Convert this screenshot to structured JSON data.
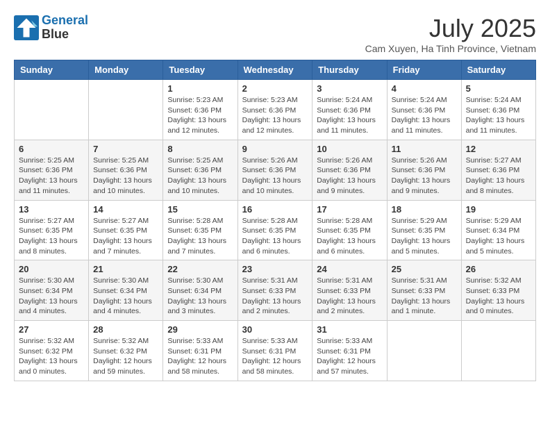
{
  "header": {
    "logo_line1": "General",
    "logo_line2": "Blue",
    "month": "July 2025",
    "location": "Cam Xuyen, Ha Tinh Province, Vietnam"
  },
  "weekdays": [
    "Sunday",
    "Monday",
    "Tuesday",
    "Wednesday",
    "Thursday",
    "Friday",
    "Saturday"
  ],
  "weeks": [
    [
      {
        "day": "",
        "info": ""
      },
      {
        "day": "",
        "info": ""
      },
      {
        "day": "1",
        "info": "Sunrise: 5:23 AM\nSunset: 6:36 PM\nDaylight: 13 hours and 12 minutes."
      },
      {
        "day": "2",
        "info": "Sunrise: 5:23 AM\nSunset: 6:36 PM\nDaylight: 13 hours and 12 minutes."
      },
      {
        "day": "3",
        "info": "Sunrise: 5:24 AM\nSunset: 6:36 PM\nDaylight: 13 hours and 11 minutes."
      },
      {
        "day": "4",
        "info": "Sunrise: 5:24 AM\nSunset: 6:36 PM\nDaylight: 13 hours and 11 minutes."
      },
      {
        "day": "5",
        "info": "Sunrise: 5:24 AM\nSunset: 6:36 PM\nDaylight: 13 hours and 11 minutes."
      }
    ],
    [
      {
        "day": "6",
        "info": "Sunrise: 5:25 AM\nSunset: 6:36 PM\nDaylight: 13 hours and 11 minutes."
      },
      {
        "day": "7",
        "info": "Sunrise: 5:25 AM\nSunset: 6:36 PM\nDaylight: 13 hours and 10 minutes."
      },
      {
        "day": "8",
        "info": "Sunrise: 5:25 AM\nSunset: 6:36 PM\nDaylight: 13 hours and 10 minutes."
      },
      {
        "day": "9",
        "info": "Sunrise: 5:26 AM\nSunset: 6:36 PM\nDaylight: 13 hours and 10 minutes."
      },
      {
        "day": "10",
        "info": "Sunrise: 5:26 AM\nSunset: 6:36 PM\nDaylight: 13 hours and 9 minutes."
      },
      {
        "day": "11",
        "info": "Sunrise: 5:26 AM\nSunset: 6:36 PM\nDaylight: 13 hours and 9 minutes."
      },
      {
        "day": "12",
        "info": "Sunrise: 5:27 AM\nSunset: 6:36 PM\nDaylight: 13 hours and 8 minutes."
      }
    ],
    [
      {
        "day": "13",
        "info": "Sunrise: 5:27 AM\nSunset: 6:35 PM\nDaylight: 13 hours and 8 minutes."
      },
      {
        "day": "14",
        "info": "Sunrise: 5:27 AM\nSunset: 6:35 PM\nDaylight: 13 hours and 7 minutes."
      },
      {
        "day": "15",
        "info": "Sunrise: 5:28 AM\nSunset: 6:35 PM\nDaylight: 13 hours and 7 minutes."
      },
      {
        "day": "16",
        "info": "Sunrise: 5:28 AM\nSunset: 6:35 PM\nDaylight: 13 hours and 6 minutes."
      },
      {
        "day": "17",
        "info": "Sunrise: 5:28 AM\nSunset: 6:35 PM\nDaylight: 13 hours and 6 minutes."
      },
      {
        "day": "18",
        "info": "Sunrise: 5:29 AM\nSunset: 6:35 PM\nDaylight: 13 hours and 5 minutes."
      },
      {
        "day": "19",
        "info": "Sunrise: 5:29 AM\nSunset: 6:34 PM\nDaylight: 13 hours and 5 minutes."
      }
    ],
    [
      {
        "day": "20",
        "info": "Sunrise: 5:30 AM\nSunset: 6:34 PM\nDaylight: 13 hours and 4 minutes."
      },
      {
        "day": "21",
        "info": "Sunrise: 5:30 AM\nSunset: 6:34 PM\nDaylight: 13 hours and 4 minutes."
      },
      {
        "day": "22",
        "info": "Sunrise: 5:30 AM\nSunset: 6:34 PM\nDaylight: 13 hours and 3 minutes."
      },
      {
        "day": "23",
        "info": "Sunrise: 5:31 AM\nSunset: 6:33 PM\nDaylight: 13 hours and 2 minutes."
      },
      {
        "day": "24",
        "info": "Sunrise: 5:31 AM\nSunset: 6:33 PM\nDaylight: 13 hours and 2 minutes."
      },
      {
        "day": "25",
        "info": "Sunrise: 5:31 AM\nSunset: 6:33 PM\nDaylight: 13 hours and 1 minute."
      },
      {
        "day": "26",
        "info": "Sunrise: 5:32 AM\nSunset: 6:33 PM\nDaylight: 13 hours and 0 minutes."
      }
    ],
    [
      {
        "day": "27",
        "info": "Sunrise: 5:32 AM\nSunset: 6:32 PM\nDaylight: 13 hours and 0 minutes."
      },
      {
        "day": "28",
        "info": "Sunrise: 5:32 AM\nSunset: 6:32 PM\nDaylight: 12 hours and 59 minutes."
      },
      {
        "day": "29",
        "info": "Sunrise: 5:33 AM\nSunset: 6:31 PM\nDaylight: 12 hours and 58 minutes."
      },
      {
        "day": "30",
        "info": "Sunrise: 5:33 AM\nSunset: 6:31 PM\nDaylight: 12 hours and 58 minutes."
      },
      {
        "day": "31",
        "info": "Sunrise: 5:33 AM\nSunset: 6:31 PM\nDaylight: 12 hours and 57 minutes."
      },
      {
        "day": "",
        "info": ""
      },
      {
        "day": "",
        "info": ""
      }
    ]
  ]
}
